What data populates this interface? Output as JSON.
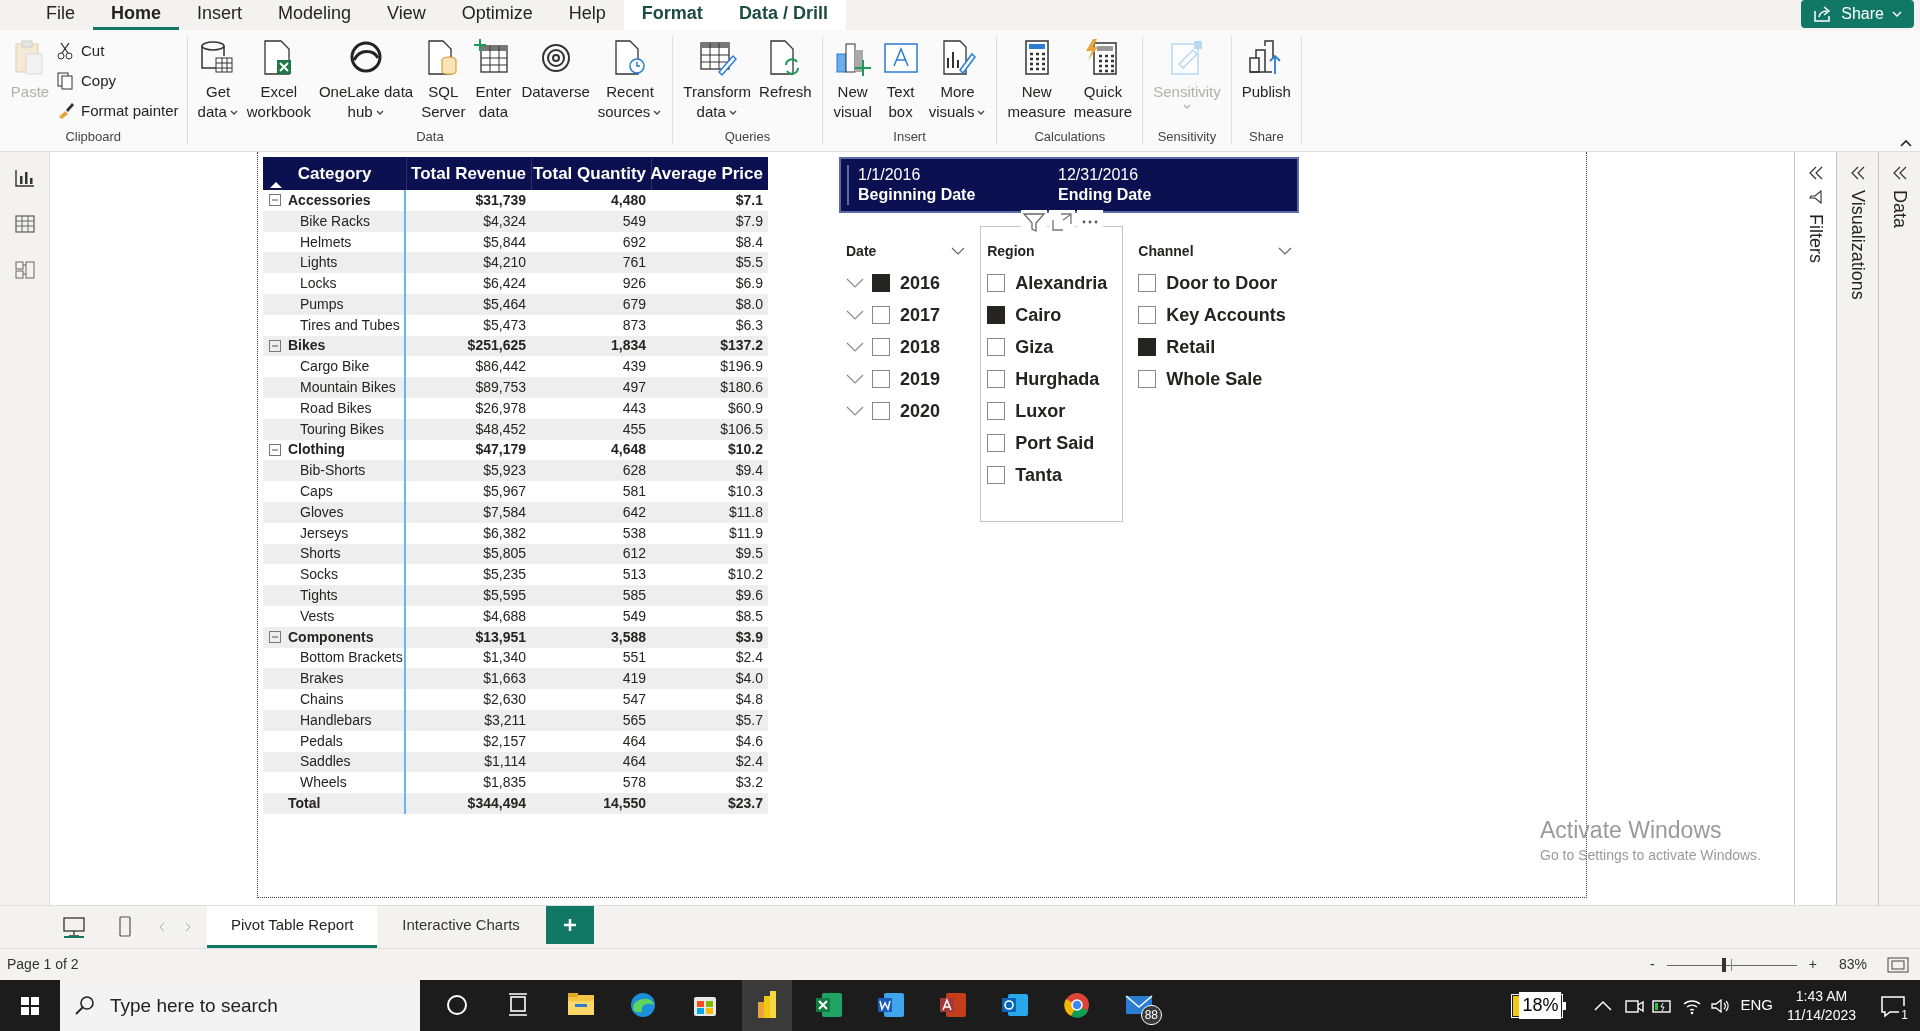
{
  "menu_tabs": [
    {
      "label": "File",
      "selected": false,
      "contextual": false
    },
    {
      "label": "Home",
      "selected": true,
      "contextual": false
    },
    {
      "label": "Insert",
      "selected": false,
      "contextual": false
    },
    {
      "label": "Modeling",
      "selected": false,
      "contextual": false
    },
    {
      "label": "View",
      "selected": false,
      "contextual": false
    },
    {
      "label": "Optimize",
      "selected": false,
      "contextual": false
    },
    {
      "label": "Help",
      "selected": false,
      "contextual": false
    },
    {
      "label": "Format",
      "selected": false,
      "contextual": true
    },
    {
      "label": "Data / Drill",
      "selected": false,
      "contextual": true
    }
  ],
  "share_button": "Share",
  "ribbon_groups": [
    {
      "label": "Clipboard",
      "buttons": [
        {
          "kind": "large",
          "lines": [
            "Paste"
          ],
          "disabled": true,
          "dropdown": false
        },
        {
          "kind": "small",
          "lines": [
            "Cut"
          ],
          "disabled": false,
          "dropdown": false
        },
        {
          "kind": "small",
          "lines": [
            "Copy"
          ],
          "disabled": false,
          "dropdown": false
        },
        {
          "kind": "small",
          "lines": [
            "Format painter"
          ],
          "disabled": false,
          "dropdown": false
        }
      ]
    },
    {
      "label": "Data",
      "buttons": [
        {
          "kind": "large",
          "lines": [
            "Get",
            "data"
          ],
          "disabled": false,
          "dropdown": true
        },
        {
          "kind": "large",
          "lines": [
            "Excel",
            "workbook"
          ],
          "disabled": false,
          "dropdown": false
        },
        {
          "kind": "large",
          "lines": [
            "OneLake data",
            "hub"
          ],
          "disabled": false,
          "dropdown": true
        },
        {
          "kind": "large",
          "lines": [
            "SQL",
            "Server"
          ],
          "disabled": false,
          "dropdown": false
        },
        {
          "kind": "large",
          "lines": [
            "Enter",
            "data"
          ],
          "disabled": false,
          "dropdown": false
        },
        {
          "kind": "large",
          "lines": [
            "Dataverse"
          ],
          "disabled": false,
          "dropdown": false
        },
        {
          "kind": "large",
          "lines": [
            "Recent",
            "sources"
          ],
          "disabled": false,
          "dropdown": true
        }
      ]
    },
    {
      "label": "Queries",
      "buttons": [
        {
          "kind": "large",
          "lines": [
            "Transform",
            "data"
          ],
          "disabled": false,
          "dropdown": true
        },
        {
          "kind": "large",
          "lines": [
            "Refresh"
          ],
          "disabled": false,
          "dropdown": false
        }
      ]
    },
    {
      "label": "Insert",
      "buttons": [
        {
          "kind": "large",
          "lines": [
            "New",
            "visual"
          ],
          "disabled": false,
          "dropdown": false
        },
        {
          "kind": "large",
          "lines": [
            "Text",
            "box"
          ],
          "disabled": false,
          "dropdown": false
        },
        {
          "kind": "large",
          "lines": [
            "More",
            "visuals"
          ],
          "disabled": false,
          "dropdown": true
        }
      ]
    },
    {
      "label": "Calculations",
      "buttons": [
        {
          "kind": "large",
          "lines": [
            "New",
            "measure"
          ],
          "disabled": false,
          "dropdown": false
        },
        {
          "kind": "large",
          "lines": [
            "Quick",
            "measure"
          ],
          "disabled": false,
          "dropdown": false
        }
      ]
    },
    {
      "label": "Sensitivity",
      "buttons": [
        {
          "kind": "large",
          "lines": [
            "Sensitivity"
          ],
          "disabled": true,
          "dropdown": true
        }
      ]
    },
    {
      "label": "Share",
      "buttons": [
        {
          "kind": "large",
          "lines": [
            "Publish"
          ],
          "disabled": false,
          "dropdown": false
        }
      ]
    }
  ],
  "table": {
    "columns": [
      "Category",
      "Total Revenue",
      "Total Quantity",
      "Average Price"
    ],
    "rows": [
      {
        "kind": "group",
        "expanded": true,
        "cells": [
          "Accessories",
          "$31,739",
          "4,480",
          "$7.1"
        ]
      },
      {
        "kind": "item",
        "cells": [
          "Bike Racks",
          "$4,324",
          "549",
          "$7.9"
        ]
      },
      {
        "kind": "item",
        "cells": [
          "Helmets",
          "$5,844",
          "692",
          "$8.4"
        ]
      },
      {
        "kind": "item",
        "cells": [
          "Lights",
          "$4,210",
          "761",
          "$5.5"
        ]
      },
      {
        "kind": "item",
        "cells": [
          "Locks",
          "$6,424",
          "926",
          "$6.9"
        ]
      },
      {
        "kind": "item",
        "cells": [
          "Pumps",
          "$5,464",
          "679",
          "$8.0"
        ]
      },
      {
        "kind": "item",
        "cells": [
          "Tires and Tubes",
          "$5,473",
          "873",
          "$6.3"
        ]
      },
      {
        "kind": "group",
        "expanded": true,
        "cells": [
          "Bikes",
          "$251,625",
          "1,834",
          "$137.2"
        ]
      },
      {
        "kind": "item",
        "cells": [
          "Cargo Bike",
          "$86,442",
          "439",
          "$196.9"
        ]
      },
      {
        "kind": "item",
        "cells": [
          "Mountain Bikes",
          "$89,753",
          "497",
          "$180.6"
        ]
      },
      {
        "kind": "item",
        "cells": [
          "Road Bikes",
          "$26,978",
          "443",
          "$60.9"
        ]
      },
      {
        "kind": "item",
        "cells": [
          "Touring Bikes",
          "$48,452",
          "455",
          "$106.5"
        ]
      },
      {
        "kind": "group",
        "expanded": true,
        "cells": [
          "Clothing",
          "$47,179",
          "4,648",
          "$10.2"
        ]
      },
      {
        "kind": "item",
        "cells": [
          "Bib-Shorts",
          "$5,923",
          "628",
          "$9.4"
        ]
      },
      {
        "kind": "item",
        "cells": [
          "Caps",
          "$5,967",
          "581",
          "$10.3"
        ]
      },
      {
        "kind": "item",
        "cells": [
          "Gloves",
          "$7,584",
          "642",
          "$11.8"
        ]
      },
      {
        "kind": "item",
        "cells": [
          "Jerseys",
          "$6,382",
          "538",
          "$11.9"
        ]
      },
      {
        "kind": "item",
        "cells": [
          "Shorts",
          "$5,805",
          "612",
          "$9.5"
        ]
      },
      {
        "kind": "item",
        "cells": [
          "Socks",
          "$5,235",
          "513",
          "$10.2"
        ]
      },
      {
        "kind": "item",
        "cells": [
          "Tights",
          "$5,595",
          "585",
          "$9.6"
        ]
      },
      {
        "kind": "item",
        "cells": [
          "Vests",
          "$4,688",
          "549",
          "$8.5"
        ]
      },
      {
        "kind": "group",
        "expanded": true,
        "cells": [
          "Components",
          "$13,951",
          "3,588",
          "$3.9"
        ]
      },
      {
        "kind": "item",
        "cells": [
          "Bottom Brackets",
          "$1,340",
          "551",
          "$2.4"
        ]
      },
      {
        "kind": "item",
        "cells": [
          "Brakes",
          "$1,663",
          "419",
          "$4.0"
        ]
      },
      {
        "kind": "item",
        "cells": [
          "Chains",
          "$2,630",
          "547",
          "$4.8"
        ]
      },
      {
        "kind": "item",
        "cells": [
          "Handlebars",
          "$3,211",
          "565",
          "$5.7"
        ]
      },
      {
        "kind": "item",
        "cells": [
          "Pedals",
          "$2,157",
          "464",
          "$4.6"
        ]
      },
      {
        "kind": "item",
        "cells": [
          "Saddles",
          "$1,114",
          "464",
          "$2.4"
        ]
      },
      {
        "kind": "item",
        "cells": [
          "Wheels",
          "$1,835",
          "578",
          "$3.2"
        ]
      },
      {
        "kind": "total",
        "cells": [
          "Total",
          "$344,494",
          "14,550",
          "$23.7"
        ]
      }
    ]
  },
  "date_card": [
    {
      "value": "1/1/2016",
      "label": "Beginning Date"
    },
    {
      "value": "12/31/2016",
      "label": "Ending Date"
    }
  ],
  "slicers": [
    {
      "title": "Date",
      "dropdown": true,
      "focused": false,
      "items": [
        {
          "label": "2016",
          "checked": true,
          "expandable": true
        },
        {
          "label": "2017",
          "checked": false,
          "expandable": true
        },
        {
          "label": "2018",
          "checked": false,
          "expandable": true
        },
        {
          "label": "2019",
          "checked": false,
          "expandable": true
        },
        {
          "label": "2020",
          "checked": false,
          "expandable": true
        }
      ]
    },
    {
      "title": "Region",
      "dropdown": false,
      "focused": true,
      "items": [
        {
          "label": "Alexandria",
          "checked": false,
          "expandable": false
        },
        {
          "label": "Cairo",
          "checked": true,
          "expandable": false
        },
        {
          "label": "Giza",
          "checked": false,
          "expandable": false
        },
        {
          "label": "Hurghada",
          "checked": false,
          "expandable": false
        },
        {
          "label": "Luxor",
          "checked": false,
          "expandable": false
        },
        {
          "label": "Port Said",
          "checked": false,
          "expandable": false
        },
        {
          "label": "Tanta",
          "checked": false,
          "expandable": false
        }
      ]
    },
    {
      "title": "Channel",
      "dropdown": true,
      "focused": false,
      "items": [
        {
          "label": "Door to Door",
          "checked": false,
          "expandable": false
        },
        {
          "label": "Key Accounts",
          "checked": false,
          "expandable": false
        },
        {
          "label": "Retail",
          "checked": true,
          "expandable": false
        },
        {
          "label": "Whole Sale",
          "checked": false,
          "expandable": false
        }
      ]
    }
  ],
  "side_panes": [
    {
      "label": "Filters"
    },
    {
      "label": "Visualizations"
    },
    {
      "label": "Data"
    }
  ],
  "page_tabs": [
    {
      "label": "Pivot Table Report",
      "selected": true
    },
    {
      "label": "Interactive Charts",
      "selected": false
    }
  ],
  "status_bar": {
    "page": "Page 1 of 2",
    "zoom_slider": {
      "level": 0.44
    },
    "zoom": "83%",
    "zoom_out": "-",
    "zoom_in": "+"
  },
  "activation_notice": {
    "title": "Activate Windows",
    "subtitle": "Go to Settings to activate Windows."
  },
  "taskbar": {
    "search_placeholder": "Type here to search",
    "battery": "18%",
    "mail_badge": "88",
    "language": "ENG",
    "time": "1:43 AM",
    "date": "11/14/2023",
    "notification_count": "1"
  }
}
